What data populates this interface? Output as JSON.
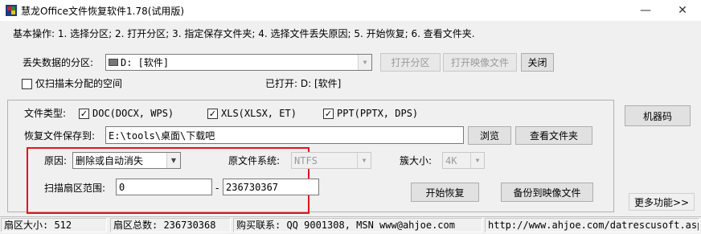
{
  "window": {
    "title": "慧龙Office文件恢复软件1.78(试用版)",
    "minimize": "—",
    "close": "✕"
  },
  "steps": "基本操作: 1. 选择分区; 2. 打开分区; 3. 指定保存文件夹; 4. 选择文件丢失原因; 5. 开始恢复; 6. 查看文件夹.",
  "partition": {
    "label": "丢失数据的分区:",
    "selected": "D: [软件]",
    "open_btn": "打开分区",
    "open_image_btn": "打开映像文件",
    "close_btn": "关闭",
    "unallocated_label": "仅扫描未分配的空间",
    "opened_label": "已打开: D: [软件]"
  },
  "filetypes": {
    "label": "文件类型:",
    "doc": "DOC(DOCX, WPS)",
    "xls": "XLS(XLSX, ET)",
    "ppt": "PPT(PPTX, DPS)"
  },
  "save": {
    "label": "恢复文件保存到:",
    "path": "E:\\tools\\桌面\\下载吧",
    "browse_btn": "浏览",
    "view_btn": "查看文件夹"
  },
  "options": {
    "reason_label": "原因:",
    "reason_value": "删除或自动消失",
    "fs_label": "原文件系统:",
    "fs_value": "NTFS",
    "cluster_label": "簇大小:",
    "cluster_value": "4K",
    "range_label": "扫描扇区范围:",
    "range_start": "0",
    "range_sep": "-",
    "range_end": "236730367",
    "start_btn": "开始恢复",
    "backup_btn": "备份到映像文件"
  },
  "side": {
    "machine_code_btn": "机器码",
    "more_btn": "更多功能>>"
  },
  "status": {
    "sector_size": "扇区大小:  512",
    "sector_total": "扇区总数:  236730368",
    "contact": "购买联系: QQ 9001308, MSN www@ahjoe.com",
    "url": "http://www.ahjoe.com/datrescusoft.asp"
  }
}
